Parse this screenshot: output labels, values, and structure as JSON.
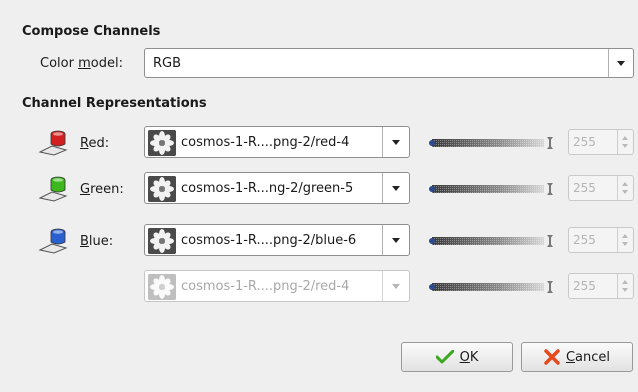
{
  "dialog": {
    "section_compose": "Compose Channels",
    "color_model_label_pre": "Color ",
    "color_model_label_mnemonic": "m",
    "color_model_label_post": "odel:",
    "color_model_value": "RGB",
    "section_channels": "Channel Representations"
  },
  "channels": [
    {
      "label_mnemonic": "R",
      "label_rest": "ed:",
      "source": "cosmos-1-R....png-2/red-4",
      "value": "255",
      "color": "#d22020",
      "enabled": true
    },
    {
      "label_mnemonic": "G",
      "label_rest": "reen:",
      "source": "cosmos-1-R...ng-2/green-5",
      "value": "255",
      "color": "#3cb81e",
      "enabled": true
    },
    {
      "label_mnemonic": "B",
      "label_rest": "lue:",
      "source": "cosmos-1-R....png-2/blue-6",
      "value": "255",
      "color": "#2a5fd0",
      "enabled": true
    },
    {
      "source": "cosmos-1-R....png-2/red-4",
      "value": "255",
      "enabled": false
    }
  ],
  "buttons": {
    "ok_mnemonic": "O",
    "ok_rest": "K",
    "cancel_mnemonic": "C",
    "cancel_rest": "ancel"
  },
  "colors": {
    "ok_check": "#3aa81c",
    "cancel_x": "#e44a1c"
  }
}
